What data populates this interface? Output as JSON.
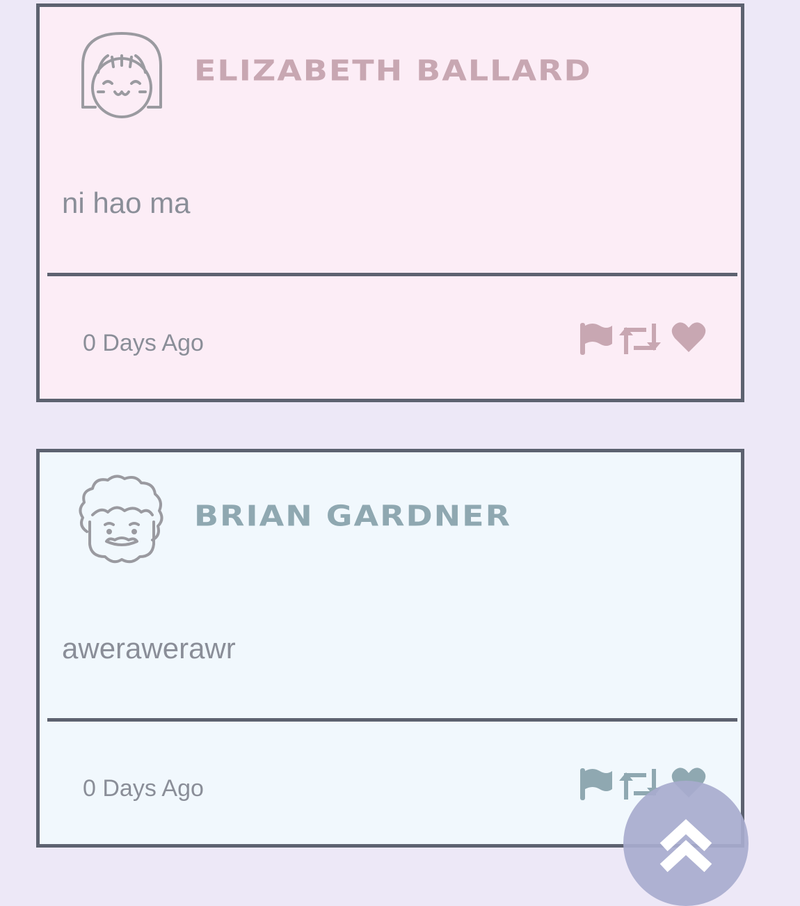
{
  "posts": [
    {
      "username": "Elizabeth Ballard",
      "message": "ni hao ma",
      "timestamp": "0 Days Ago",
      "theme": "pink",
      "avatar_icon": "girl-face-icon"
    },
    {
      "username": "Brian Gardner",
      "message": "awerawerawr",
      "timestamp": "0 Days Ago",
      "theme": "blue",
      "avatar_icon": "curly-hair-face-icon"
    }
  ],
  "actions": [
    "flag-icon",
    "retweet-icon",
    "heart-icon"
  ],
  "colors": {
    "background": "#ede8f7",
    "card_border": "#5d6270",
    "pink_card": "#fcedf6",
    "blue_card": "#f1f8fd",
    "pink_accent": "#c8a7b2",
    "blue_accent": "#8fa8b1",
    "scroll_button": "#a8abce"
  }
}
